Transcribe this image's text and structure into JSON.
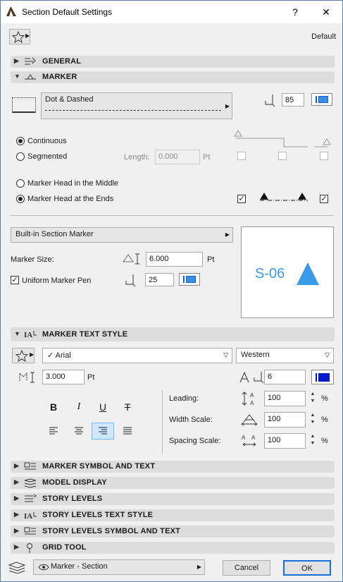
{
  "window": {
    "title": "Section Default Settings",
    "help": "?",
    "close": "✕"
  },
  "favorites": {
    "label": "Default"
  },
  "sections": {
    "general": "GENERAL",
    "marker": "MARKER",
    "marker_text_style": "MARKER TEXT STYLE",
    "marker_symbol_and_text": "MARKER SYMBOL AND TEXT",
    "model_display": "MODEL DISPLAY",
    "story_levels": "STORY LEVELS",
    "story_levels_text_style": "STORY LEVELS TEXT STYLE",
    "story_levels_symbol_and_text": "STORY LEVELS SYMBOL AND TEXT",
    "grid_tool": "GRID TOOL"
  },
  "marker": {
    "line_type": "Dot & Dashed",
    "pen_number": "85",
    "continuous": "Continuous",
    "segmented": "Segmented",
    "length_label": "Length:",
    "length_value": "0.000",
    "length_unit": "Pt",
    "head_middle": "Marker Head in the Middle",
    "head_ends": "Marker Head at the Ends",
    "marker_type": "Built-in Section Marker",
    "size_label": "Marker Size:",
    "size_value": "6.000",
    "size_unit": "Pt",
    "uniform_pen": "Uniform Marker Pen",
    "uniform_pen_value": "25",
    "preview_text": "S-06",
    "preview_color": "#3a9ae8"
  },
  "text_style": {
    "font": "Arial",
    "script": "Western",
    "size_value": "3.000",
    "size_unit": "Pt",
    "pen_value": "6",
    "bold": "B",
    "italic": "I",
    "underline": "U",
    "strike": "T",
    "leading_label": "Leading:",
    "leading_value": "100",
    "width_label": "Width Scale:",
    "width_value": "100",
    "spacing_label": "Spacing Scale:",
    "spacing_value": "100",
    "percent": "%"
  },
  "footer": {
    "layer": "Marker - Section",
    "cancel": "Cancel",
    "ok": "OK"
  }
}
